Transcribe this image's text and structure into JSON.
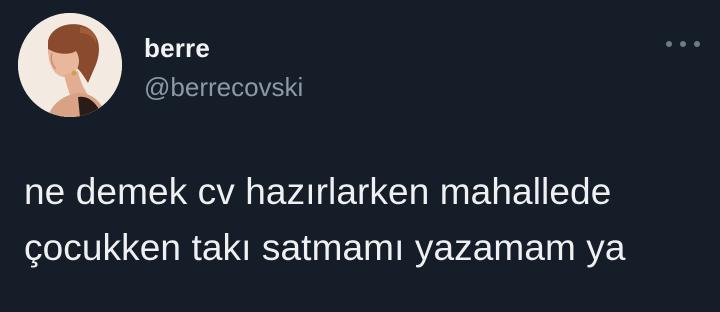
{
  "tweet": {
    "author": {
      "display_name": "berre",
      "handle": "@berrecovski",
      "avatar": "avatar-photo"
    },
    "more_icon": "more-dots-icon",
    "text_lines": [
      "ne demek cv hazırlarken mahallede",
      "çocukken takı satmamı yazamam ya"
    ]
  },
  "colors": {
    "background": "#151d28",
    "text": "#eef0f2",
    "handle": "#8b98a5",
    "more_dots": "#6e7a86"
  }
}
